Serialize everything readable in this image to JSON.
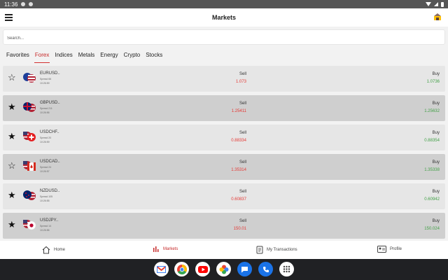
{
  "status_bar": {
    "time": "11:36"
  },
  "app_bar": {
    "title": "Markets"
  },
  "search": {
    "placeholder": "Search..."
  },
  "tabs": [
    {
      "label": "Favorites"
    },
    {
      "label": "Forex",
      "active": true
    },
    {
      "label": "Indices"
    },
    {
      "label": "Metals"
    },
    {
      "label": "Energy"
    },
    {
      "label": "Crypto"
    },
    {
      "label": "Stocks"
    }
  ],
  "instruments": [
    {
      "symbol": "EURUSD..",
      "spread": "Spread 66",
      "time": "10:26:59",
      "favorite": false,
      "sell_label": "Sell",
      "sell": "1.073",
      "buy_label": "Buy",
      "buy": "1.0736",
      "flag_icon": "eur-usd-flag-icon"
    },
    {
      "symbol": "GBPUSD..",
      "spread": "Spread 211",
      "time": "10:26:56",
      "favorite": true,
      "sell_label": "Sell",
      "sell": "1.25411",
      "buy_label": "Buy",
      "buy": "1.25632",
      "flag_icon": "gbp-usd-flag-icon"
    },
    {
      "symbol": "USDCHF..",
      "spread": "Spread 20",
      "time": "10:26:59",
      "favorite": true,
      "sell_label": "Sell",
      "sell": "0.88334",
      "buy_label": "Buy",
      "buy": "0.88354",
      "flag_icon": "usd-chf-flag-icon"
    },
    {
      "symbol": "USDCAD..",
      "spread": "Spread 24",
      "time": "10:26:57",
      "favorite": false,
      "sell_label": "Sell",
      "sell": "1.35314",
      "buy_label": "Buy",
      "buy": "1.35338",
      "flag_icon": "usd-cad-flag-icon"
    },
    {
      "symbol": "NZDUSD..",
      "spread": "Spread 105",
      "time": "10:26:55",
      "favorite": true,
      "sell_label": "Sell",
      "sell": "0.60837",
      "buy_label": "Buy",
      "buy": "0.60942",
      "flag_icon": "nzd-usd-flag-icon"
    },
    {
      "symbol": "USDJPY..",
      "spread": "Spread 14",
      "time": "10:26:56",
      "favorite": true,
      "sell_label": "Sell",
      "sell": "150.01",
      "buy_label": "Buy",
      "buy": "150.024",
      "flag_icon": "usd-jpy-flag-icon"
    }
  ],
  "bottom_nav": [
    {
      "label": "Home",
      "icon": "home-icon"
    },
    {
      "label": "Markets",
      "icon": "chart-bars-icon",
      "active": true
    },
    {
      "label": "My Transactions",
      "icon": "document-icon"
    },
    {
      "label": "Profile",
      "icon": "profile-card-icon"
    }
  ],
  "dock_apps": [
    "gmail-icon",
    "chrome-icon",
    "youtube-icon",
    "photos-icon",
    "messages-icon",
    "phone-icon",
    "app-drawer-icon"
  ],
  "colors": {
    "sell": "#e53935",
    "buy": "#43a047",
    "accent": "#d32f2f"
  }
}
